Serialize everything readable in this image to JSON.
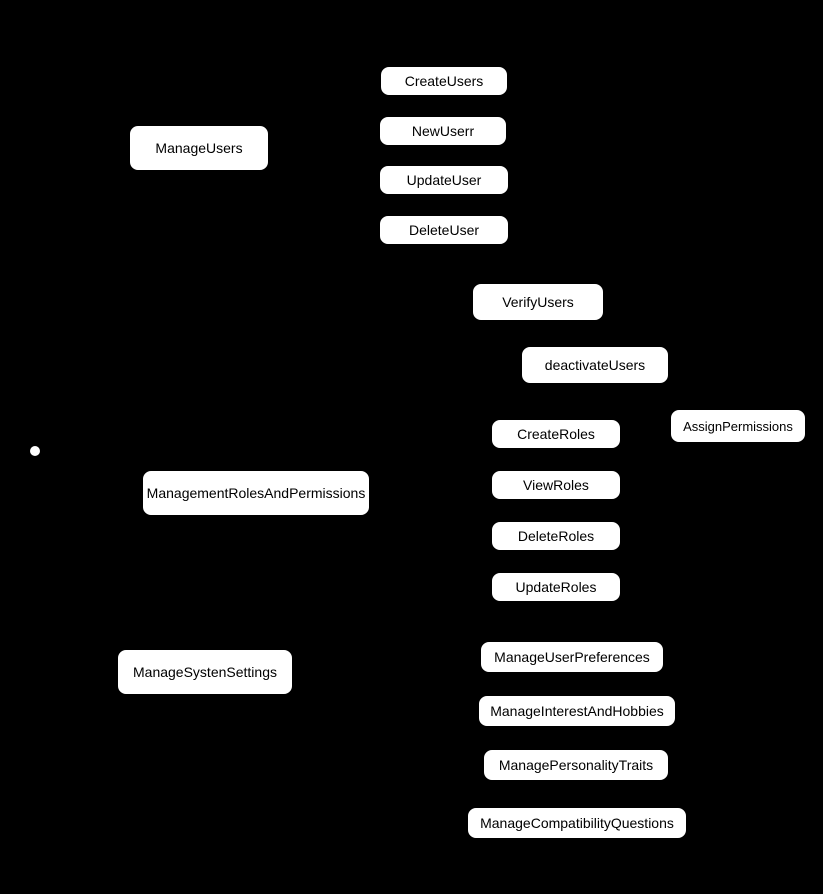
{
  "diagram": {
    "type": "hierarchy",
    "root_marker": "actor-dot",
    "nodes": {
      "manageUsers": "ManageUsers",
      "createUsers": "CreateUsers",
      "newUserr": "NewUserr",
      "updateUser": "UpdateUser",
      "deleteUser": "DeleteUser",
      "verifyUsers": "VerifyUsers",
      "deactivateUsers": "deactivateUsers",
      "assignPermissions": "AssignPermissions",
      "managementRolesAndPermissions": "ManagementRolesAndPermissions",
      "createRoles": "CreateRoles",
      "viewRoles": "ViewRoles",
      "deleteRoles": "DeleteRoles",
      "updateRoles": "UpdateRoles",
      "manageSystemSettings": "ManageSystenSettings",
      "manageUserPreferences": "ManageUserPreferences",
      "manageInterestAndHobbies": "ManageInterestAndHobbies",
      "managePersonalityTraits": "ManagePersonalityTraits",
      "manageCompatibilityQuestions": "ManageCompatibilityQuestions"
    },
    "edges": [
      [
        "actor-dot",
        "manageUsers"
      ],
      [
        "actor-dot",
        "managementRolesAndPermissions"
      ],
      [
        "actor-dot",
        "manageSystemSettings"
      ],
      [
        "manageUsers",
        "createUsers"
      ],
      [
        "manageUsers",
        "newUserr"
      ],
      [
        "manageUsers",
        "updateUser"
      ],
      [
        "manageUsers",
        "deleteUser"
      ],
      [
        "manageUsers",
        "verifyUsers"
      ],
      [
        "manageUsers",
        "deactivateUsers"
      ],
      [
        "managementRolesAndPermissions",
        "assignPermissions"
      ],
      [
        "managementRolesAndPermissions",
        "createRoles"
      ],
      [
        "managementRolesAndPermissions",
        "viewRoles"
      ],
      [
        "managementRolesAndPermissions",
        "deleteRoles"
      ],
      [
        "managementRolesAndPermissions",
        "updateRoles"
      ],
      [
        "manageSystemSettings",
        "manageUserPreferences"
      ],
      [
        "manageSystemSettings",
        "manageInterestAndHobbies"
      ],
      [
        "manageSystemSettings",
        "managePersonalityTraits"
      ],
      [
        "manageSystemSettings",
        "manageCompatibilityQuestions"
      ]
    ]
  }
}
